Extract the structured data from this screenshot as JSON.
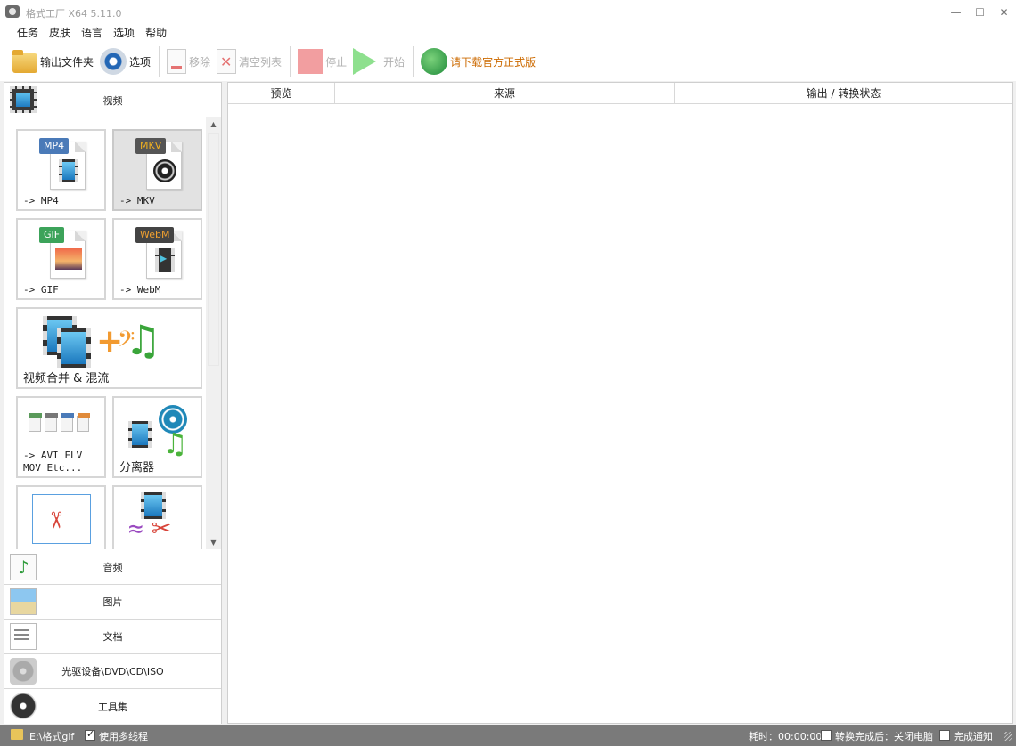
{
  "window": {
    "title": "格式工厂 X64 5.11.0",
    "controls": {
      "minimize": "—",
      "maximize": "☐",
      "close": "✕"
    }
  },
  "menu": [
    "任务",
    "皮肤",
    "语言",
    "选项",
    "帮助"
  ],
  "toolbar": {
    "output_folder": "输出文件夹",
    "options": "选项",
    "remove": "移除",
    "clear_list": "清空列表",
    "stop": "停止",
    "start": "开始",
    "download_official": "请下载官方正式版"
  },
  "sidebar": {
    "video": {
      "label": "视频",
      "tiles": [
        {
          "badge": "MP4",
          "label": "-> MP4"
        },
        {
          "badge": "MKV",
          "label": "-> MKV",
          "selected": true
        },
        {
          "badge": "GIF",
          "label": "-> GIF"
        },
        {
          "badge": "WebM",
          "label": "-> WebM"
        },
        {
          "label": "视频合并 & 混流"
        },
        {
          "label": "-> AVI FLV\nMOV Etc..."
        },
        {
          "label": "分离器"
        },
        {
          "label": ""
        },
        {
          "label": ""
        }
      ]
    },
    "categories": [
      "音频",
      "图片",
      "文档",
      "光驱设备\\DVD\\CD\\ISO",
      "工具集"
    ]
  },
  "table": {
    "columns": [
      "预览",
      "来源",
      "输出 / 转换状态"
    ],
    "rows": []
  },
  "status": {
    "output_path": "E:\\格式gif",
    "multithread": "使用多线程",
    "multithread_checked": true,
    "elapsed": "耗时：00:00:00",
    "after_complete": "转换完成后：关闭电脑",
    "after_complete_checked": false,
    "notify": "完成通知",
    "notify_checked": false
  },
  "icons": {
    "app": "format-factory-icon",
    "output_folder": "folder-icon",
    "options": "options-icon",
    "remove": "remove-icon",
    "clear": "clear-list-icon",
    "stop": "stop-icon",
    "start": "start-icon",
    "download": "globe-icon"
  },
  "colors": {
    "link": "#cc6a00",
    "disabled": "#b0b0b0",
    "status_bar": "#7a7a7a"
  }
}
